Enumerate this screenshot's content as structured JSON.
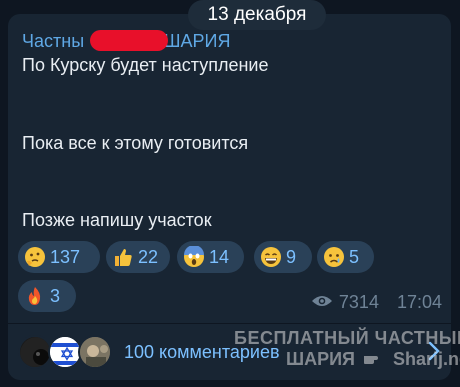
{
  "date_separator": "13 декабря",
  "message": {
    "sender_visible_start": "Частны",
    "sender_visible_end": "ШАРИЯ",
    "lines": [
      "По Курску будет наступление",
      "Пока все к этому готовится",
      "Позже напишу участок"
    ],
    "reactions": [
      {
        "icon": "thinking-face-icon",
        "count": "137"
      },
      {
        "icon": "thumbs-up-icon",
        "count": "22"
      },
      {
        "icon": "screaming-face-icon",
        "count": "14"
      },
      {
        "icon": "grinning-face-icon",
        "count": "9"
      },
      {
        "icon": "crying-face-icon",
        "count": "5"
      },
      {
        "icon": "fire-icon",
        "count": "3"
      }
    ],
    "views": "7314",
    "time": "17:04"
  },
  "comments": {
    "label": "100 комментариев"
  },
  "watermark": {
    "line1": "БЕСПЛАТНЫЙ ЧАСТНЫЙ",
    "line2_left": "ШАРИЯ",
    "line2_right": "Sharij.net"
  },
  "colors": {
    "background": "#0e1621",
    "bubble": "#182533",
    "accent": "#5fa8e5",
    "reaction_chip": "#2a4158",
    "redaction": "#e8102a"
  }
}
